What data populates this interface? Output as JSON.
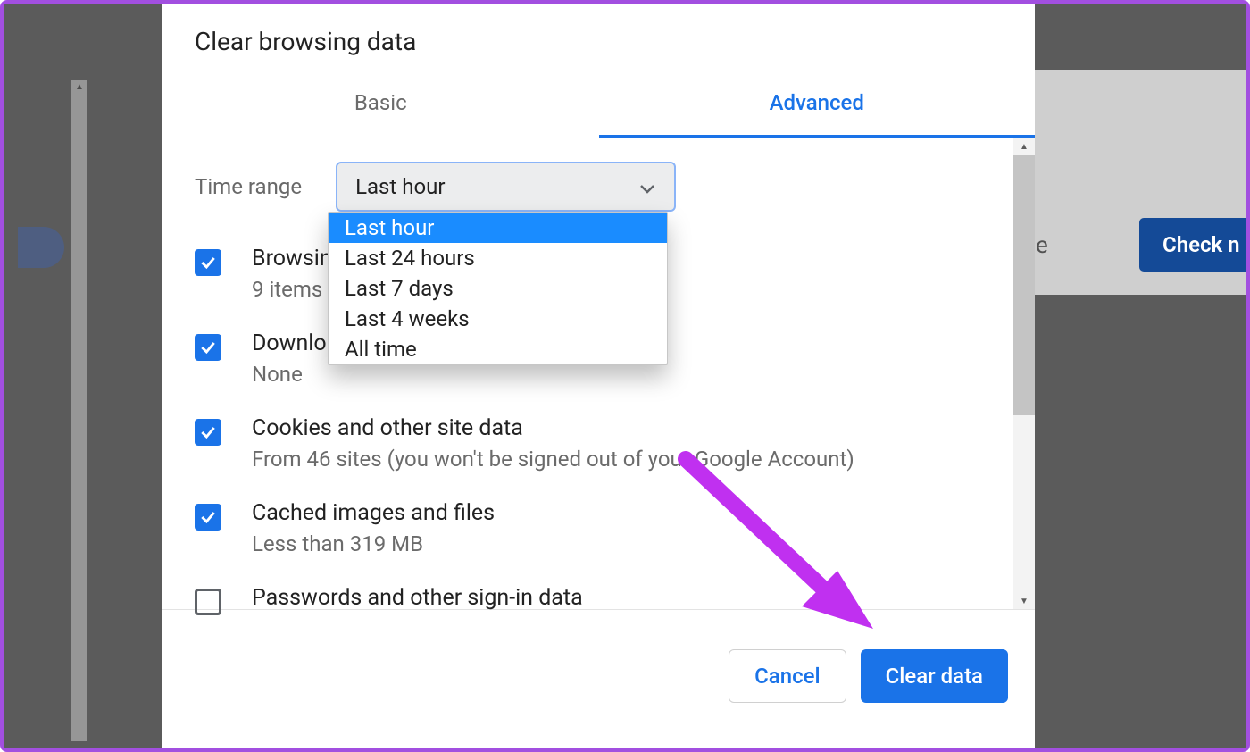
{
  "modal": {
    "title": "Clear browsing data",
    "tabs": {
      "basic": "Basic",
      "advanced": "Advanced"
    },
    "time_range": {
      "label": "Time range",
      "selected": "Last hour",
      "options": [
        "Last hour",
        "Last 24 hours",
        "Last 7 days",
        "Last 4 weeks",
        "All time"
      ]
    },
    "items": [
      {
        "title": "Browsing history",
        "sub": "9 items",
        "checked": true
      },
      {
        "title": "Download history",
        "sub": "None",
        "checked": true
      },
      {
        "title": "Cookies and other site data",
        "sub": "From 46 sites (you won't be signed out of your Google Account)",
        "checked": true
      },
      {
        "title": "Cached images and files",
        "sub": "Less than 319 MB",
        "checked": true
      },
      {
        "title": "Passwords and other sign-in data",
        "sub": "",
        "checked": false
      }
    ],
    "buttons": {
      "cancel": "Cancel",
      "clear": "Clear data"
    }
  },
  "background": {
    "right_char": "e",
    "right_button": "Check n"
  }
}
